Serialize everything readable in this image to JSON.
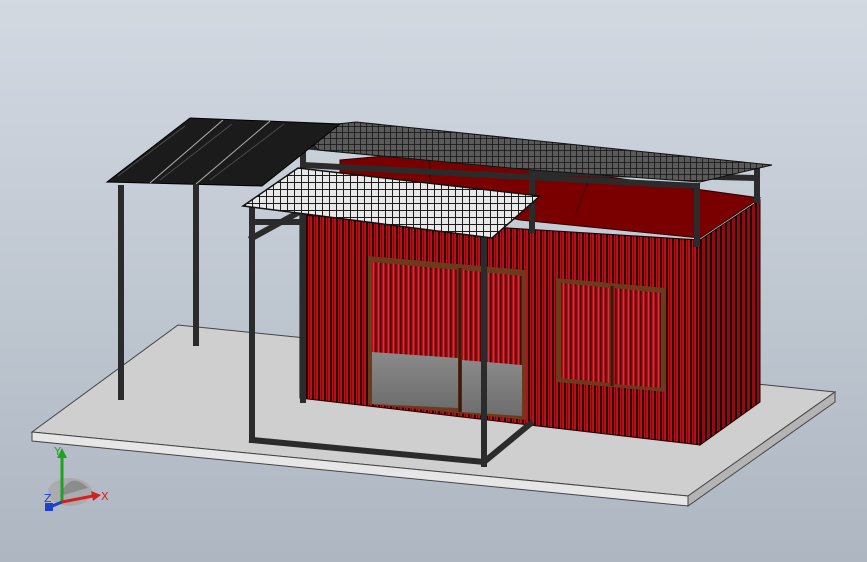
{
  "viewport": {
    "background_top": "#d3d9e1",
    "background_bottom": "#aeb6c2"
  },
  "model": {
    "wall_color": "#b3121a",
    "wall_stripe_color": "#2a0304",
    "roof_color": "#7a0000",
    "frame_color": "#2b2b2b",
    "slab_color": "#c8c8c8",
    "frame_wood_color": "#6e3a1c"
  },
  "triad": {
    "x_label": "X",
    "y_label": "Y",
    "z_label": "Z",
    "x_color": "#d42020",
    "y_color": "#22a022",
    "z_color": "#1f3fd0",
    "icon": "coordinate-triad-icon"
  }
}
